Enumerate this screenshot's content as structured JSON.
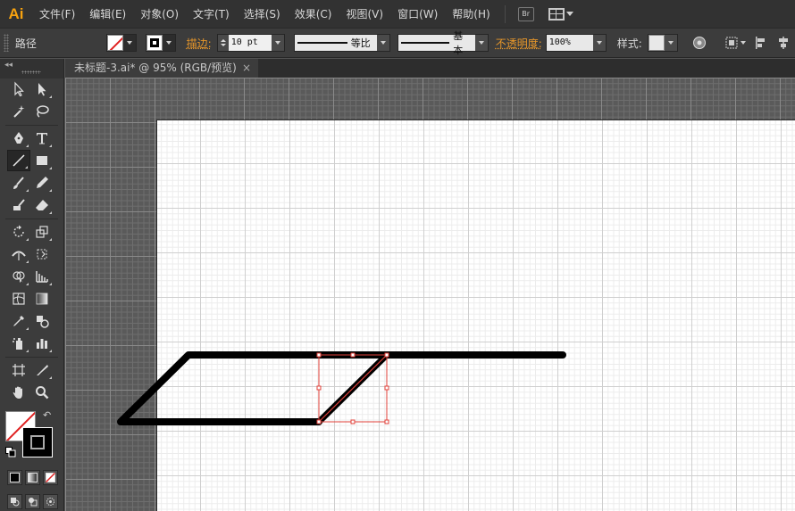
{
  "app": {
    "logo": "Ai"
  },
  "menu": {
    "items": [
      "文件(F)",
      "编辑(E)",
      "对象(O)",
      "文字(T)",
      "选择(S)",
      "效果(C)",
      "视图(V)",
      "窗口(W)",
      "帮助(H)"
    ],
    "bridge_label": "Br"
  },
  "control": {
    "object_type": "路径",
    "stroke_label": "描边:",
    "stroke_weight": "10 pt",
    "variable_width": "等比",
    "brush_def": "基本",
    "opacity_label": "不透明度:",
    "opacity_value": "100%",
    "style_label": "样式:"
  },
  "document": {
    "tab_title": "未标题-3.ai* @ 95% (RGB/预览)",
    "close_glyph": "×"
  },
  "toolbar": {
    "collapse_glyph": "◂◂",
    "swap_glyph": "↶",
    "tools": [
      [
        "selection-tool",
        "direct-selection-tool"
      ],
      [
        "magic-wand-tool",
        "lasso-tool"
      ],
      [
        "pen-tool",
        "type-tool"
      ],
      [
        "line-segment-tool",
        "rectangle-tool"
      ],
      [
        "paintbrush-tool",
        "pencil-tool"
      ],
      [
        "blob-brush-tool",
        "eraser-tool"
      ],
      [
        "rotate-tool",
        "scale-tool"
      ],
      [
        "width-tool",
        "free-transform-tool"
      ],
      [
        "shape-builder-tool",
        "perspective-grid-tool"
      ],
      [
        "mesh-tool",
        "gradient-tool"
      ],
      [
        "eyedropper-tool",
        "blend-tool"
      ],
      [
        "symbol-sprayer-tool",
        "column-graph-tool"
      ],
      [
        "artboard-tool",
        "slice-tool"
      ],
      [
        "hand-tool",
        "zoom-tool"
      ]
    ],
    "active_tool": "line-segment-tool"
  },
  "colors": {
    "stroke_color": "#000000",
    "fill": "none",
    "selection_color": "#e0403a",
    "accent": "#f7a20f"
  }
}
